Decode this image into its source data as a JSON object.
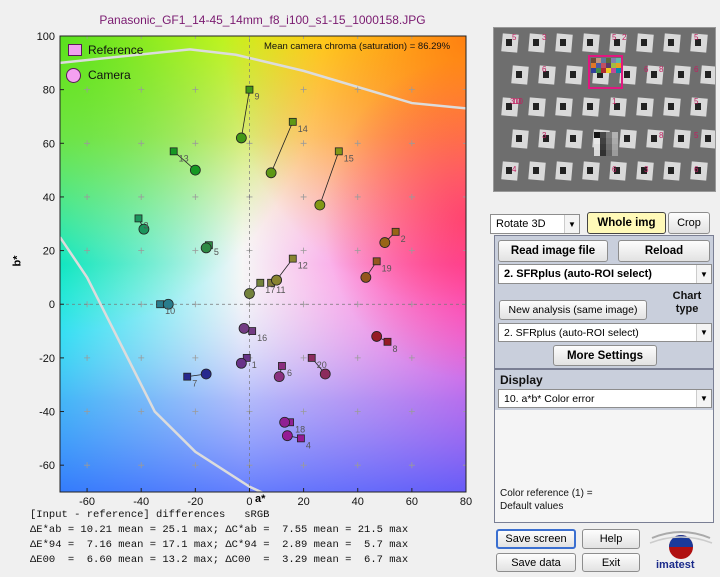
{
  "window": {
    "title": "Panasonic_GF1_14-45_14mm_f8_i100_s1-15_1000158.JPG"
  },
  "chart_data": {
    "type": "scatter",
    "title": "Panasonic_GF1_14-45_14mm_f8_i100_s1-15_1000158.JPG",
    "xlabel": "a*",
    "ylabel": "b*",
    "xlim": [
      -70,
      80
    ],
    "ylim": [
      -70,
      100
    ],
    "xticks": [
      -60,
      -40,
      -20,
      0,
      20,
      40,
      60,
      80
    ],
    "yticks": [
      100,
      80,
      60,
      40,
      20,
      0,
      -20,
      -40,
      -60
    ],
    "grid": "crosses",
    "legend": {
      "placement": "top-left",
      "entries": [
        "Reference",
        "Camera"
      ]
    },
    "annotation": "Mean camera chroma (saturation) = 86.29%",
    "series": [
      {
        "name": "Reference",
        "marker": "square",
        "points": [
          {
            "patch": "1",
            "x": -1,
            "y": -20
          },
          {
            "patch": "2",
            "x": 54,
            "y": 27
          },
          {
            "patch": "3",
            "x": -41,
            "y": 32
          },
          {
            "patch": "4",
            "x": 19,
            "y": -50
          },
          {
            "patch": "5",
            "x": -15,
            "y": 22
          },
          {
            "patch": "6",
            "x": 12,
            "y": -23
          },
          {
            "patch": "7",
            "x": -23,
            "y": -27
          },
          {
            "patch": "8",
            "x": 51,
            "y": -14
          },
          {
            "patch": "9",
            "x": 0,
            "y": 80
          },
          {
            "patch": "10",
            "x": -33,
            "y": 0
          },
          {
            "patch": "11",
            "x": 8,
            "y": 8
          },
          {
            "patch": "12",
            "x": 16,
            "y": 17
          },
          {
            "patch": "13",
            "x": -28,
            "y": 57
          },
          {
            "patch": "14",
            "x": 16,
            "y": 68
          },
          {
            "patch": "15",
            "x": 33,
            "y": 57
          },
          {
            "patch": "16",
            "x": 1,
            "y": -10
          },
          {
            "patch": "17",
            "x": 4,
            "y": 8
          },
          {
            "patch": "18",
            "x": 15,
            "y": -44
          },
          {
            "patch": "19",
            "x": 47,
            "y": 16
          },
          {
            "patch": "20",
            "x": 23,
            "y": -20
          }
        ]
      },
      {
        "name": "Camera",
        "marker": "circle",
        "points": [
          {
            "patch": "1",
            "x": -3,
            "y": -22
          },
          {
            "patch": "2",
            "x": 50,
            "y": 23
          },
          {
            "patch": "3",
            "x": -39,
            "y": 28
          },
          {
            "patch": "4",
            "x": 14,
            "y": -49
          },
          {
            "patch": "5",
            "x": -16,
            "y": 21
          },
          {
            "patch": "6",
            "x": 11,
            "y": -27
          },
          {
            "patch": "7",
            "x": -16,
            "y": -26
          },
          {
            "patch": "8",
            "x": 47,
            "y": -12
          },
          {
            "patch": "9",
            "x": -3,
            "y": 62
          },
          {
            "patch": "10",
            "x": -30,
            "y": 0
          },
          {
            "patch": "11",
            "x": 10,
            "y": 9
          },
          {
            "patch": "12",
            "x": 10,
            "y": 9
          },
          {
            "patch": "13",
            "x": -20,
            "y": 50
          },
          {
            "patch": "14",
            "x": 8,
            "y": 49
          },
          {
            "patch": "15",
            "x": 26,
            "y": 37
          },
          {
            "patch": "16",
            "x": -2,
            "y": -9
          },
          {
            "patch": "17",
            "x": 0,
            "y": 4
          },
          {
            "patch": "18",
            "x": 13,
            "y": -44
          },
          {
            "patch": "19",
            "x": 43,
            "y": 10
          },
          {
            "patch": "20",
            "x": 28,
            "y": -26
          }
        ]
      }
    ]
  },
  "stats": {
    "header_left": "[Input - reference] differences",
    "header_right": "sRGB",
    "row1": {
      "e_label": "ΔE*ab",
      "e_val": "= 10.21 mean = 25.1 max;",
      "c_label": "ΔC*ab",
      "c_val": "=  7.55 mean = 21.5 max"
    },
    "row2": {
      "e_label": "ΔE*94",
      "e_val": "=  7.16 mean = 17.1 max;",
      "c_label": "ΔC*94",
      "c_val": "=  2.89 mean =  5.7 max"
    },
    "row3": {
      "e_label": "ΔE00",
      "e_val": "=  6.60 mean = 13.2 max;",
      "c_label": "ΔC00",
      "c_val": "=  3.29 mean =  6.7 max"
    }
  },
  "controls": {
    "rotate_select": "Rotate 3D",
    "whole_img": "Whole img",
    "crop": "Crop",
    "read_image": "Read image file",
    "reload": "Reload",
    "module_select": "2. SFRplus (auto-ROI select)",
    "new_analysis": "New analysis (same image)",
    "chart_type_label": "Chart type",
    "chart_type_select": "2. SFRplus (auto-ROI select)",
    "more_settings": "More Settings",
    "display_label": "Display",
    "display_select": "10. a*b* Color error",
    "color_ref_note_1": "Color reference (1) =",
    "color_ref_note_2": "Default values",
    "save_screen": "Save screen",
    "help": "Help",
    "save_data": "Save data",
    "exit": "Exit",
    "logo_text": "imatest"
  },
  "thumbnail": {
    "labels": [
      "5",
      "6",
      "3",
      "4",
      "5",
      "6",
      "5",
      "6",
      "6",
      "8",
      "10",
      "1",
      "10",
      "7",
      "3",
      "8",
      "5",
      "6",
      "3",
      "5",
      "2",
      "3"
    ]
  }
}
